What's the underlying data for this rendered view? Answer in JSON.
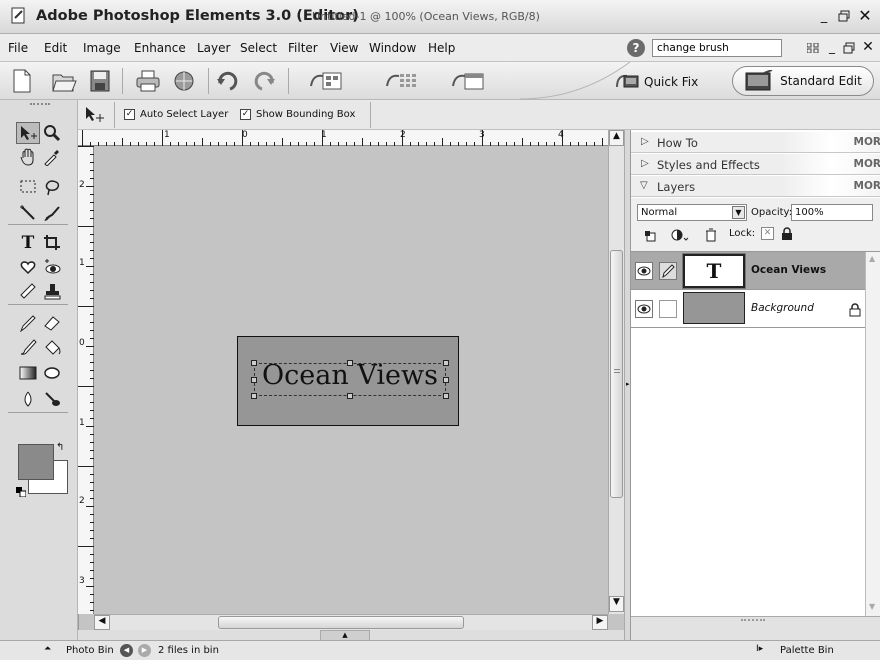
{
  "window": {
    "app_title": "Adobe Photoshop Elements 3.0 (Editor)",
    "doc_title": "Untitled-1 @ 100% (Ocean Views, RGB/8)"
  },
  "menu": [
    "File",
    "Edit",
    "Image",
    "Enhance",
    "Layer",
    "Select",
    "Filter",
    "View",
    "Window",
    "Help"
  ],
  "search": {
    "value": "change brush"
  },
  "modes": {
    "quick_fix": "Quick Fix",
    "standard_edit": "Standard Edit"
  },
  "options": {
    "auto_select_label": "Auto Select Layer",
    "bounding_box_label": "Show Bounding Box"
  },
  "ruler": {
    "top_labels": [
      "1",
      "0",
      "1",
      "2",
      "3",
      "4"
    ],
    "left_labels": [
      "2",
      "1",
      "0",
      "1",
      "2",
      "3"
    ]
  },
  "canvas": {
    "text": "Ocean Views"
  },
  "palette": {
    "panels": [
      {
        "title": "How To",
        "more": "MOR"
      },
      {
        "title": "Styles and Effects",
        "more": "MOR"
      },
      {
        "title": "Layers",
        "more": "MOR"
      }
    ],
    "blend_mode": "Normal",
    "opacity_label": "Opacity:",
    "opacity_value": "100%",
    "lock_label": "Lock:",
    "layers": [
      {
        "name": "Ocean Views",
        "thumb": "T"
      },
      {
        "name": "Background",
        "thumb": ""
      }
    ]
  },
  "status": {
    "photo_bin": "Photo Bin",
    "files": "2 files in bin",
    "palette_bin": "Palette Bin"
  },
  "colors": {
    "canvas_bg": "#c4c4c4",
    "image": "#969696",
    "fg_swatch": "#8a8a8a"
  }
}
